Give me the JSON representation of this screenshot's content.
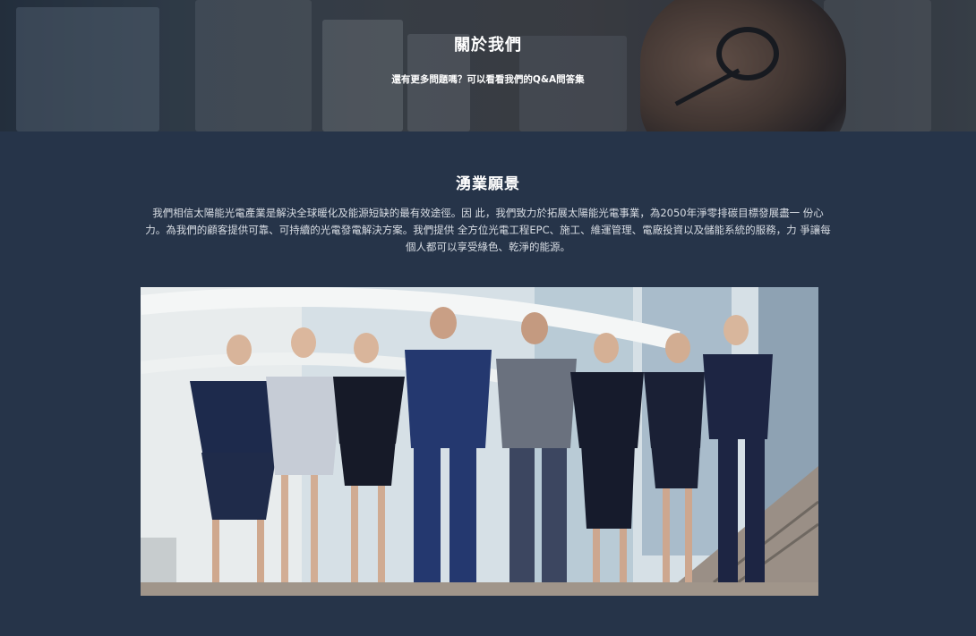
{
  "hero": {
    "title": "關於我們",
    "subtitle": "還有更多問題嗎？可以看看我們的Q&A問答集"
  },
  "vision": {
    "title": "湧業願景",
    "body": "我們相信太陽能光電產業是解決全球暖化及能源短缺的最有效途徑。因 此，我們致力於拓展太陽能光電事業，為2050年淨零排碳目標發展盡一 份心力。為我們的顧客提供可靠、可持續的光電發電解決方案。我們提供 全方位光電工程EPC、施工、維運管理、電廠投資以及儲能系統的服務，力 爭讓每個人都可以享受綠色、乾淨的能源。"
  },
  "photo": {
    "icon": "team-photo"
  },
  "colors": {
    "background": "#263449",
    "text": "#ffffff",
    "body_text": "#d8dde4"
  }
}
